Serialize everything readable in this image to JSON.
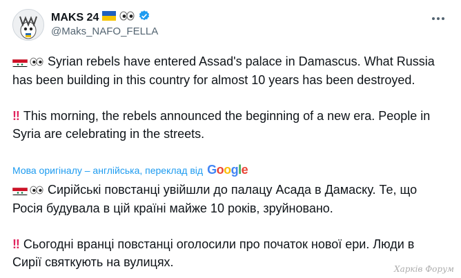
{
  "author": {
    "display_name": "MAKS 24",
    "handle": "@Maks_NAFO_FELLA",
    "verified": true,
    "flag": "ukraine-flag-icon",
    "eyes": "eyes-icon"
  },
  "tweet": {
    "paragraph_1": "Syrian rebels have entered Assad's palace in Damascus. What Russia has been building in this country for almost 10 years has been destroyed.",
    "paragraph_2": "This morning, the rebels announced the beginning of a new era. People in Syria are celebrating in the streets."
  },
  "translation": {
    "note": "Мова оригіналу – англійська, переклад від",
    "provider": "Google",
    "paragraph_1": "Сирійські повстанці увійшли до палацу Асада в Дамаску. Те, що Росія будувала в цій країні майже 10 років, зруйновано.",
    "paragraph_2": "Сьогодні вранці повстанці оголосили про початок нової ери. Люди в Сирії святкують на вулицях."
  },
  "watermark": "Харків Форум",
  "colors": {
    "link": "#1d9bf0",
    "text": "#0f1419",
    "secondary": "#536471",
    "verified": "#1d9bf0",
    "alert": "#e0245e"
  }
}
